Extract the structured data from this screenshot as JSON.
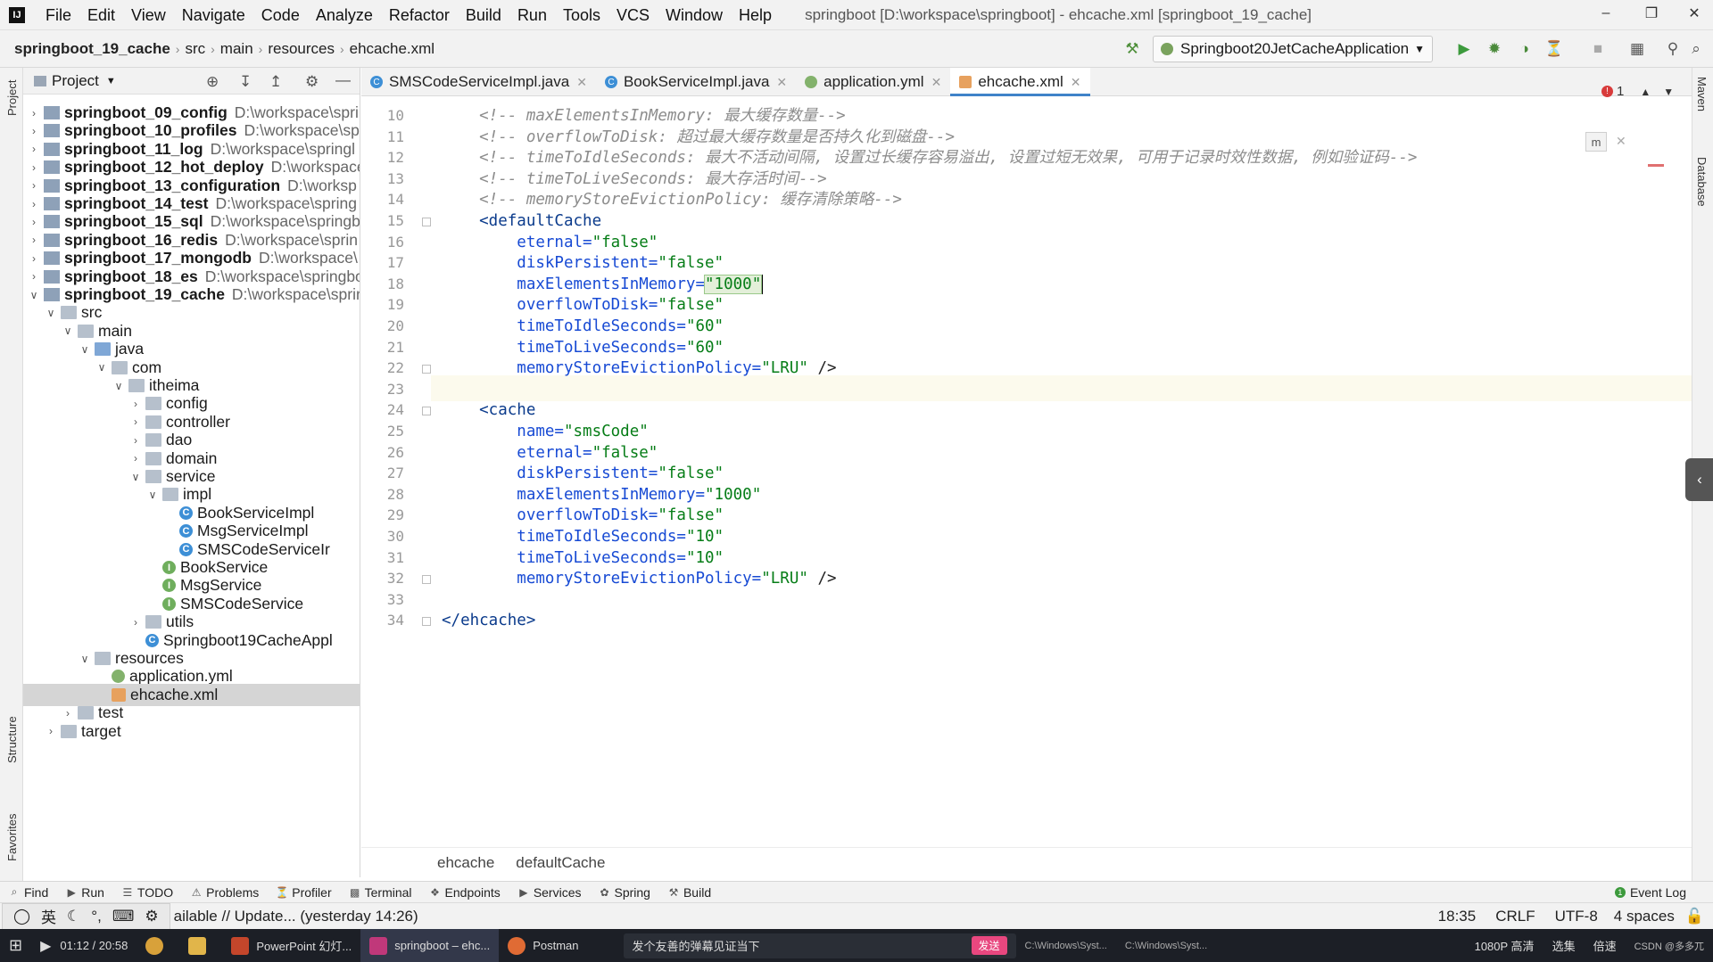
{
  "window": {
    "menu": [
      "File",
      "Edit",
      "View",
      "Navigate",
      "Code",
      "Analyze",
      "Refactor",
      "Build",
      "Run",
      "Tools",
      "VCS",
      "Window",
      "Help"
    ],
    "title": "springboot [D:\\workspace\\springboot] - ehcache.xml [springboot_19_cache]"
  },
  "navbar": {
    "crumbs": [
      "springboot_19_cache",
      "src",
      "main",
      "resources",
      "ehcache.xml"
    ],
    "run_config": "Springboot20JetCacheApplication"
  },
  "project": {
    "header": "Project",
    "tree": [
      {
        "name": "springboot_09_config",
        "path": "D:\\workspace\\spri",
        "level": 0,
        "arrow": ">",
        "icon": "module",
        "bold": true
      },
      {
        "name": "springboot_10_profiles",
        "path": "D:\\workspace\\sp",
        "level": 0,
        "arrow": ">",
        "icon": "module",
        "bold": true
      },
      {
        "name": "springboot_11_log",
        "path": "D:\\workspace\\springl",
        "level": 0,
        "arrow": ">",
        "icon": "module",
        "bold": true
      },
      {
        "name": "springboot_12_hot_deploy",
        "path": "D:\\workspace",
        "level": 0,
        "arrow": ">",
        "icon": "module",
        "bold": true
      },
      {
        "name": "springboot_13_configuration",
        "path": "D:\\worksp",
        "level": 0,
        "arrow": ">",
        "icon": "module",
        "bold": true
      },
      {
        "name": "springboot_14_test",
        "path": "D:\\workspace\\spring",
        "level": 0,
        "arrow": ">",
        "icon": "module",
        "bold": true
      },
      {
        "name": "springboot_15_sql",
        "path": "D:\\workspace\\springb",
        "level": 0,
        "arrow": ">",
        "icon": "module",
        "bold": true
      },
      {
        "name": "springboot_16_redis",
        "path": "D:\\workspace\\sprin",
        "level": 0,
        "arrow": ">",
        "icon": "module",
        "bold": true
      },
      {
        "name": "springboot_17_mongodb",
        "path": "D:\\workspace\\",
        "level": 0,
        "arrow": ">",
        "icon": "module",
        "bold": true
      },
      {
        "name": "springboot_18_es",
        "path": "D:\\workspace\\springbo",
        "level": 0,
        "arrow": ">",
        "icon": "module",
        "bold": true
      },
      {
        "name": "springboot_19_cache",
        "path": "D:\\workspace\\sprir",
        "level": 0,
        "arrow": "v",
        "icon": "module",
        "bold": true
      },
      {
        "name": "src",
        "path": "",
        "level": 1,
        "arrow": "v",
        "icon": "folder",
        "bold": false
      },
      {
        "name": "main",
        "path": "",
        "level": 2,
        "arrow": "v",
        "icon": "folder",
        "bold": false
      },
      {
        "name": "java",
        "path": "",
        "level": 3,
        "arrow": "v",
        "icon": "folder-blue",
        "bold": false
      },
      {
        "name": "com",
        "path": "",
        "level": 4,
        "arrow": "v",
        "icon": "folder",
        "bold": false
      },
      {
        "name": "itheima",
        "path": "",
        "level": 5,
        "arrow": "v",
        "icon": "folder",
        "bold": false
      },
      {
        "name": "config",
        "path": "",
        "level": 6,
        "arrow": ">",
        "icon": "folder",
        "bold": false
      },
      {
        "name": "controller",
        "path": "",
        "level": 6,
        "arrow": ">",
        "icon": "folder",
        "bold": false
      },
      {
        "name": "dao",
        "path": "",
        "level": 6,
        "arrow": ">",
        "icon": "folder",
        "bold": false
      },
      {
        "name": "domain",
        "path": "",
        "level": 6,
        "arrow": ">",
        "icon": "folder",
        "bold": false
      },
      {
        "name": "service",
        "path": "",
        "level": 6,
        "arrow": "v",
        "icon": "folder",
        "bold": false
      },
      {
        "name": "impl",
        "path": "",
        "level": 7,
        "arrow": "v",
        "icon": "folder",
        "bold": false
      },
      {
        "name": "BookServiceImpl",
        "path": "",
        "level": 8,
        "arrow": "",
        "icon": "class",
        "bold": false
      },
      {
        "name": "MsgServiceImpl",
        "path": "",
        "level": 8,
        "arrow": "",
        "icon": "class",
        "bold": false
      },
      {
        "name": "SMSCodeServiceIr",
        "path": "",
        "level": 8,
        "arrow": "",
        "icon": "class",
        "bold": false
      },
      {
        "name": "BookService",
        "path": "",
        "level": 7,
        "arrow": "",
        "icon": "interface",
        "bold": false
      },
      {
        "name": "MsgService",
        "path": "",
        "level": 7,
        "arrow": "",
        "icon": "interface",
        "bold": false
      },
      {
        "name": "SMSCodeService",
        "path": "",
        "level": 7,
        "arrow": "",
        "icon": "interface",
        "bold": false
      },
      {
        "name": "utils",
        "path": "",
        "level": 6,
        "arrow": ">",
        "icon": "folder",
        "bold": false
      },
      {
        "name": "Springboot19CacheAppl",
        "path": "",
        "level": 6,
        "arrow": "",
        "icon": "class",
        "bold": false
      },
      {
        "name": "resources",
        "path": "",
        "level": 3,
        "arrow": "v",
        "icon": "folder",
        "bold": false
      },
      {
        "name": "application.yml",
        "path": "",
        "level": 4,
        "arrow": "",
        "icon": "yml",
        "bold": false
      },
      {
        "name": "ehcache.xml",
        "path": "",
        "level": 4,
        "arrow": "",
        "icon": "xml",
        "bold": false,
        "selected": true
      },
      {
        "name": "test",
        "path": "",
        "level": 2,
        "arrow": ">",
        "icon": "folder",
        "bold": false
      },
      {
        "name": "target",
        "path": "",
        "level": 1,
        "arrow": ">",
        "icon": "folder",
        "bold": false
      }
    ]
  },
  "editor": {
    "tabs": [
      {
        "label": "SMSCodeServiceImpl.java",
        "icon": "class",
        "active": false
      },
      {
        "label": "BookServiceImpl.java",
        "icon": "class",
        "active": false
      },
      {
        "label": "application.yml",
        "icon": "yml",
        "active": false
      },
      {
        "label": "ehcache.xml",
        "icon": "xml",
        "active": true
      }
    ],
    "inspection_count": "1",
    "lines": [
      {
        "n": "10",
        "t": "cm",
        "text": "    <!-- maxElementsInMemory: 最大缓存数量-->"
      },
      {
        "n": "11",
        "t": "cm",
        "text": "    <!-- overflowToDisk: 超过最大缓存数量是否持久化到磁盘-->"
      },
      {
        "n": "12",
        "t": "cm",
        "text": "    <!-- timeToIdleSeconds: 最大不活动间隔, 设置过长缓存容易溢出, 设置过短无效果, 可用于记录时效性数据, 例如验证码-->"
      },
      {
        "n": "13",
        "t": "cm",
        "text": "    <!-- timeToLiveSeconds: 最大存活时间-->"
      },
      {
        "n": "14",
        "t": "cm",
        "text": "    <!-- memoryStoreEvictionPolicy: 缓存清除策略-->"
      },
      {
        "n": "15",
        "t": "tag",
        "text": "    <defaultCache"
      },
      {
        "n": "16",
        "t": "attr",
        "a": "        eternal=",
        "v": "\"false\""
      },
      {
        "n": "17",
        "t": "attr",
        "a": "        diskPersistent=",
        "v": "\"false\""
      },
      {
        "n": "18",
        "t": "attr",
        "a": "        maxElementsInMemory=",
        "v": "\"1000\"",
        "caret": true
      },
      {
        "n": "19",
        "t": "attr",
        "a": "        overflowToDisk=",
        "v": "\"false\""
      },
      {
        "n": "20",
        "t": "attr",
        "a": "        timeToIdleSeconds=",
        "v": "\"60\""
      },
      {
        "n": "21",
        "t": "attr",
        "a": "        timeToLiveSeconds=",
        "v": "\"60\""
      },
      {
        "n": "22",
        "t": "attr",
        "a": "        memoryStoreEvictionPolicy=",
        "v": "\"LRU\"",
        "tail": " />"
      },
      {
        "n": "23",
        "t": "blank",
        "text": ""
      },
      {
        "n": "24",
        "t": "tag",
        "text": "    <cache"
      },
      {
        "n": "25",
        "t": "attr",
        "a": "        name=",
        "v": "\"smsCode\""
      },
      {
        "n": "26",
        "t": "attr",
        "a": "        eternal=",
        "v": "\"false\""
      },
      {
        "n": "27",
        "t": "attr",
        "a": "        diskPersistent=",
        "v": "\"false\""
      },
      {
        "n": "28",
        "t": "attr",
        "a": "        maxElementsInMemory=",
        "v": "\"1000\""
      },
      {
        "n": "29",
        "t": "attr",
        "a": "        overflowToDisk=",
        "v": "\"false\""
      },
      {
        "n": "30",
        "t": "attr",
        "a": "        timeToIdleSeconds=",
        "v": "\"10\""
      },
      {
        "n": "31",
        "t": "attr",
        "a": "        timeToLiveSeconds=",
        "v": "\"10\""
      },
      {
        "n": "32",
        "t": "attr",
        "a": "        memoryStoreEvictionPolicy=",
        "v": "\"LRU\"",
        "tail": " />"
      },
      {
        "n": "33",
        "t": "blank",
        "text": ""
      },
      {
        "n": "34",
        "t": "tag",
        "text": "</ehcache>"
      }
    ],
    "breadcrumbs": [
      "ehcache",
      "defaultCache"
    ]
  },
  "stripes": {
    "left": [
      "Project",
      "Structure",
      "Favorites"
    ],
    "right": [
      "Maven",
      "Database"
    ]
  },
  "toolwindows": [
    "Find",
    "Run",
    "TODO",
    "Problems",
    "Profiler",
    "Terminal",
    "Endpoints",
    "Services",
    "Spring",
    "Build"
  ],
  "event_log": "Event Log",
  "statusbar": {
    "ime": [
      "英"
    ],
    "message": "ailable // Update... (yesterday 14:26)",
    "position": "18:35",
    "line_sep": "CRLF",
    "encoding": "UTF-8",
    "indent": "4 spaces"
  },
  "taskbar": {
    "time": "01:12 / 20:58",
    "tasks": [
      "PowerPoint 幻灯...",
      "springboot – ehc...",
      "Postman"
    ],
    "danmaku": "发个友善的弹幕见证当下",
    "send": "发送",
    "cmd1": "C:\\Windows\\Syst...",
    "cmd2": "C:\\Windows\\Syst...",
    "right": [
      "1080P 高清",
      "选集",
      "倍速"
    ],
    "watermark": "CSDN @多多兀"
  },
  "colors": {
    "accent": "#4083c9",
    "comment": "#8c8c8c",
    "tag": "#0b3b8c",
    "attr": "#174ad4",
    "string": "#067d17"
  }
}
